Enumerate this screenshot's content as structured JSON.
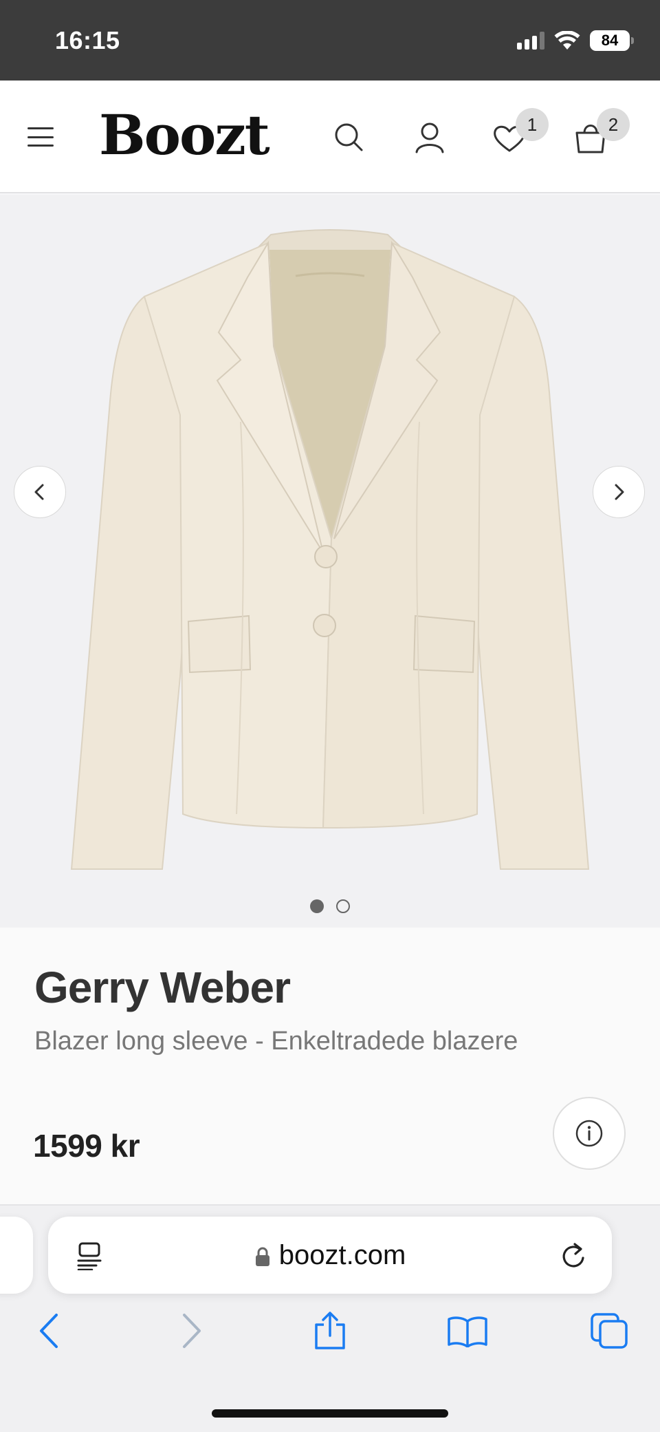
{
  "status_bar": {
    "time": "16:15",
    "battery": "84"
  },
  "header": {
    "logo": "Boozt",
    "wishlist_count": "1",
    "cart_count": "2"
  },
  "gallery": {
    "image_alt": "Cream single-breasted blazer",
    "slide_index": 1,
    "slide_count": 2
  },
  "product": {
    "brand": "Gerry Weber",
    "name": "Blazer long sleeve - Enkeltradede blazere",
    "price": "1599 kr"
  },
  "safari": {
    "url": "boozt.com"
  },
  "colors": {
    "status_bar_bg": "#3c3c3c",
    "ios_blue": "#1a7cf2",
    "blazer": "#efe7d8"
  }
}
